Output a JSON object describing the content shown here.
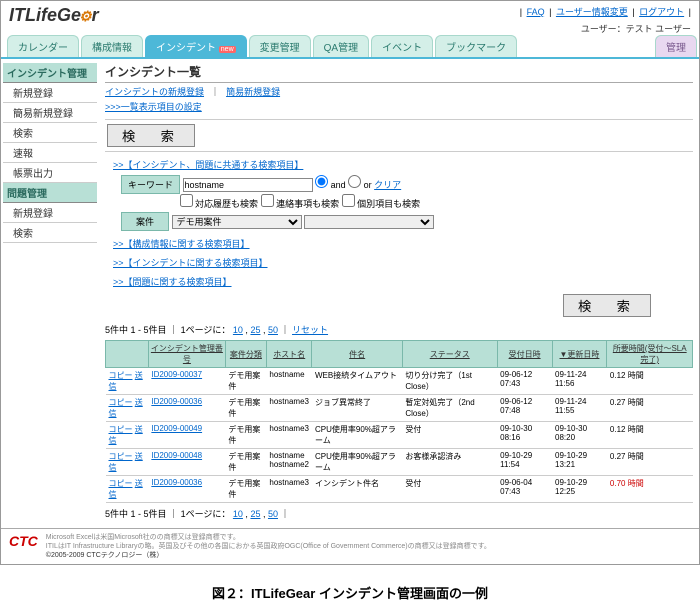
{
  "logo": {
    "text": "ITLifeGe",
    "suffix": "r"
  },
  "top_links": {
    "faq": "FAQ",
    "user_edit": "ユーザー情報変更",
    "logout": "ログアウト"
  },
  "user_label": "ユーザー：テスト ユーザー",
  "tabs": {
    "calendar": "カレンダー",
    "config": "構成情報",
    "incident": "インシデント",
    "incident_badge": "new",
    "change": "変更管理",
    "qa": "QA管理",
    "event": "イベント",
    "bookmark": "ブックマーク",
    "mgmt": "管理"
  },
  "sidebar": {
    "incident_head": "インシデント管理",
    "incident_items": [
      "新規登録",
      "簡易新規登録",
      "検索",
      "速報",
      "帳票出力"
    ],
    "problem_head": "問題管理",
    "problem_items": [
      "新規登録",
      "検索"
    ]
  },
  "page_title": "インシデント一覧",
  "new_link": "インシデントの新規登録",
  "easy_new_link": "簡易新規登録",
  "display_setting": ">>>一覧表示項目の設定",
  "search_button": "検　索",
  "section1": ">>【インシデント、問題に共通する検索項目】",
  "keyword_label": "キーワード",
  "keyword_value": "hostname",
  "and_label": "and",
  "or_label": "or",
  "clear": "クリア",
  "chk_history": "対応履歴も検索",
  "chk_contact": "連絡事項も検索",
  "chk_individual": "個別項目も検索",
  "case_label": "案件",
  "case_option": "デモ用案件",
  "section2": ">>【構成情報に関する検索項目】",
  "section3": ">>【インシデントに関する検索項目】",
  "section4": ">>【問題に関する検索項目】",
  "paging_count": "5件中 1 - 5件目",
  "paging_sep": "｜",
  "paging_perpage": "1ページに：",
  "p10": "10",
  "p25": "25",
  "p50": "50",
  "reset": "リセット",
  "columns": {
    "action": "",
    "id": "インシデント管理番号",
    "case": "案件分類",
    "host": "ホスト名",
    "subject": "件名",
    "status": "ステータス",
    "received": "受付日時",
    "updated": "▼更新日時",
    "duration": "所要時間(受付～SLA完了)"
  },
  "rows": [
    {
      "act": "コピー 送信",
      "id": "ID2009-00037",
      "case": "デモ用案件",
      "host": "hostname",
      "subject": "WEB接続タイムアウト",
      "status": "切り分け完了（1st Close）",
      "recv": "09-06-12 07:43",
      "upd": "09-11-24 11:56",
      "dur": "0.12 時間",
      "red": false
    },
    {
      "act": "コピー 送信",
      "id": "ID2009-00036",
      "case": "デモ用案件",
      "host": "hostname3",
      "subject": "ジョブ異常終了",
      "status": "暫定対処完了（2nd Close）",
      "recv": "09-06-12 07:48",
      "upd": "09-11-24 11:55",
      "dur": "0.27 時間",
      "red": false
    },
    {
      "act": "コピー 送信",
      "id": "ID2009-00049",
      "case": "デモ用案件",
      "host": "hostname3",
      "subject": "CPU使用率90%超アラーム",
      "status": "受付",
      "recv": "09-10-30 08:16",
      "upd": "09-10-30 08:20",
      "dur": "0.12 時間",
      "red": false
    },
    {
      "act": "コピー 送信",
      "id": "ID2009-00048",
      "case": "デモ用案件",
      "host": "hostname\nhostname2",
      "subject": "CPU使用率90%超アラーム",
      "status": "お客様承認済み",
      "recv": "09-10-29 11:54",
      "upd": "09-10-29 13:21",
      "dur": "0.27 時間",
      "red": false
    },
    {
      "act": "コピー 送信",
      "id": "ID2009-00036",
      "case": "デモ用案件",
      "host": "hostname3",
      "subject": "インシデント件名",
      "status": "受付",
      "recv": "09-06-04 07:43",
      "upd": "09-10-29 12:25",
      "dur": "0.70 時間",
      "red": true
    }
  ],
  "footer": {
    "ctc": "CTC",
    "line1": "Microsoft Excelは米国Microsoft社のの商標又は登録商標です。",
    "line2": "ITILはIT Infrastructure Libraryの略。英国及びその他の各国におかる英国政府OGC(Office of Government Commerce)の商標又は登録商標です。",
    "copyright": "©2005-2009 CTCテクノロジー（株）"
  },
  "caption": "図２：ITLifeGear インシデント管理画面の一例"
}
